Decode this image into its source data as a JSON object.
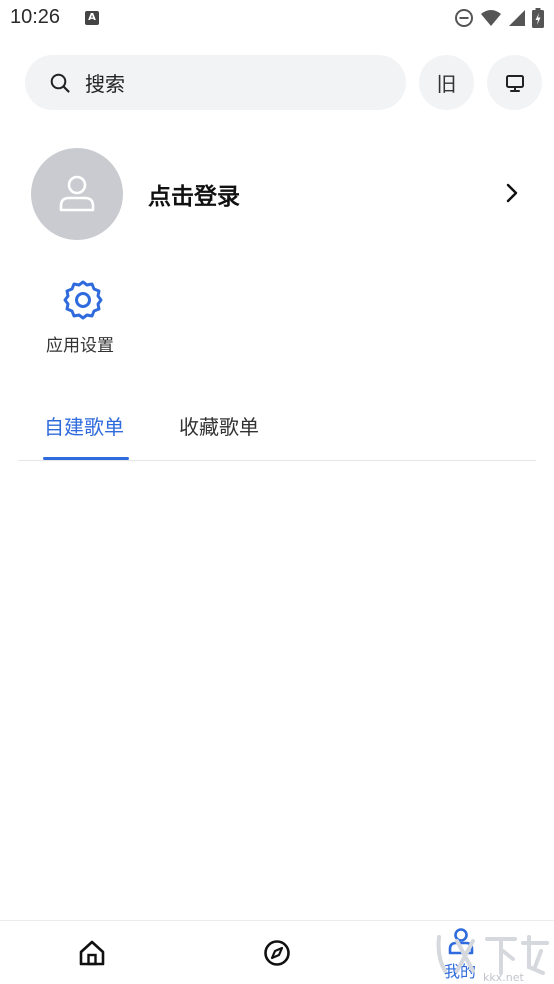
{
  "status_bar": {
    "time": "10:26",
    "notification_letter": "A"
  },
  "search": {
    "placeholder": "搜索"
  },
  "header_buttons": {
    "old_label": "旧"
  },
  "profile": {
    "login_label": "点击登录"
  },
  "shortcuts": {
    "settings_label": "应用设置"
  },
  "tabs": [
    {
      "label": "自建歌单",
      "active": true
    },
    {
      "label": "收藏歌单",
      "active": false
    }
  ],
  "bottom_nav": {
    "mine_label": "我的"
  },
  "watermark": {
    "text": "kkx.net"
  },
  "colors": {
    "accent": "#2f6bdc",
    "surface": "#f2f3f5",
    "avatar_bg": "#c9cbd0"
  },
  "icons": [
    "search-icon",
    "desktop-icon",
    "user-icon",
    "chevron-right-icon",
    "gear-icon",
    "home-icon",
    "compass-icon",
    "person-icon"
  ]
}
